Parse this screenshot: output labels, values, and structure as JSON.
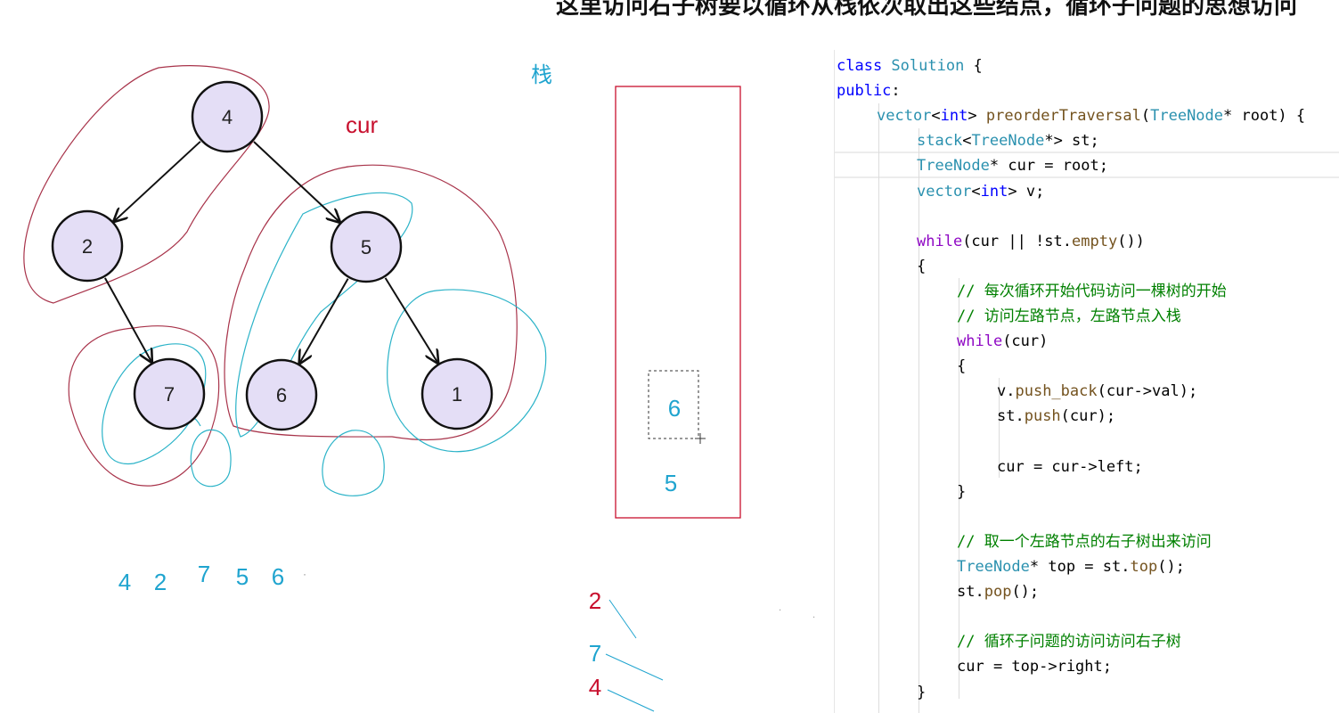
{
  "caption": "这里访问右子树要以循环从栈依次取出这些结点，循环子问题的思想访问",
  "tree": {
    "nodes": [
      {
        "id": "n4",
        "label": "4"
      },
      {
        "id": "n2",
        "label": "2"
      },
      {
        "id": "n5",
        "label": "5"
      },
      {
        "id": "n7",
        "label": "7"
      },
      {
        "id": "n6",
        "label": "6"
      },
      {
        "id": "n1",
        "label": "1"
      }
    ],
    "edges": [
      [
        "n4",
        "n2"
      ],
      [
        "n4",
        "n5"
      ],
      [
        "n2",
        "n7"
      ],
      [
        "n5",
        "n6"
      ],
      [
        "n5",
        "n1"
      ]
    ]
  },
  "annotations": {
    "cur_label": "cur",
    "stack_label": "栈",
    "stack_items": [
      "6",
      "5"
    ],
    "output_sequence": [
      "4",
      "2",
      "7",
      "5",
      "6"
    ],
    "popped": [
      "2",
      "7",
      "4"
    ]
  },
  "code": {
    "lines": [
      {
        "indent": 0,
        "tokens": [
          [
            "kw",
            "class"
          ],
          [
            "",
            ""
          ],
          [
            "ty",
            " Solution"
          ],
          [
            "",
            " {"
          ]
        ]
      },
      {
        "indent": 0,
        "tokens": [
          [
            "kw",
            "public"
          ],
          [
            "",
            ":"
          ]
        ]
      },
      {
        "indent": 1,
        "tokens": [
          [
            "ty",
            "vector"
          ],
          [
            "",
            "<"
          ],
          [
            "kw",
            "int"
          ],
          [
            "",
            "> "
          ],
          [
            "fn",
            "preorderTraversal"
          ],
          [
            "",
            "("
          ],
          [
            "ty",
            "TreeNode"
          ],
          [
            "",
            "* root) {"
          ]
        ]
      },
      {
        "indent": 2,
        "tokens": [
          [
            "ty",
            "stack"
          ],
          [
            "",
            "<"
          ],
          [
            "ty",
            "TreeNode"
          ],
          [
            "",
            "*> st;"
          ]
        ]
      },
      {
        "indent": 2,
        "tokens": [
          [
            "ty",
            "TreeNode"
          ],
          [
            "",
            "* cur = root;"
          ]
        ]
      },
      {
        "indent": 2,
        "tokens": [
          [
            "ty",
            "vector"
          ],
          [
            "",
            "<"
          ],
          [
            "kw",
            "int"
          ],
          [
            "",
            "> v;"
          ]
        ]
      },
      {
        "indent": 0,
        "tokens": []
      },
      {
        "indent": 2,
        "tokens": [
          [
            "ctl",
            "while"
          ],
          [
            "",
            "(cur || !st."
          ],
          [
            "fn",
            "empty"
          ],
          [
            "",
            "())"
          ]
        ]
      },
      {
        "indent": 2,
        "tokens": [
          [
            "",
            "{"
          ]
        ]
      },
      {
        "indent": 3,
        "tokens": [
          [
            "cm",
            "// 每次循环开始代码访问一棵树的开始"
          ]
        ]
      },
      {
        "indent": 3,
        "tokens": [
          [
            "cm",
            "// 访问左路节点，左路节点入栈"
          ]
        ]
      },
      {
        "indent": 3,
        "tokens": [
          [
            "ctl",
            "while"
          ],
          [
            "",
            "(cur)"
          ]
        ]
      },
      {
        "indent": 3,
        "tokens": [
          [
            "",
            "{"
          ]
        ]
      },
      {
        "indent": 4,
        "tokens": [
          [
            "",
            "v."
          ],
          [
            "fn",
            "push_back"
          ],
          [
            "",
            "(cur->val);"
          ]
        ]
      },
      {
        "indent": 4,
        "tokens": [
          [
            "",
            "st."
          ],
          [
            "fn",
            "push"
          ],
          [
            "",
            "(cur);"
          ]
        ]
      },
      {
        "indent": 0,
        "tokens": []
      },
      {
        "indent": 4,
        "tokens": [
          [
            "",
            "cur = cur->left;"
          ]
        ]
      },
      {
        "indent": 3,
        "tokens": [
          [
            "",
            "}"
          ]
        ]
      },
      {
        "indent": 0,
        "tokens": []
      },
      {
        "indent": 3,
        "tokens": [
          [
            "cm",
            "// 取一个左路节点的右子树出来访问"
          ]
        ]
      },
      {
        "indent": 3,
        "tokens": [
          [
            "ty",
            "TreeNode"
          ],
          [
            "",
            "* top = st."
          ],
          [
            "fn",
            "top"
          ],
          [
            "",
            "();"
          ]
        ]
      },
      {
        "indent": 3,
        "tokens": [
          [
            "",
            "st."
          ],
          [
            "fn",
            "pop"
          ],
          [
            "",
            "();"
          ]
        ]
      },
      {
        "indent": 0,
        "tokens": []
      },
      {
        "indent": 3,
        "tokens": [
          [
            "cm",
            "// 循环子问题的访问访问右子树"
          ]
        ]
      },
      {
        "indent": 3,
        "tokens": [
          [
            "",
            "cur = top->right;"
          ]
        ]
      },
      {
        "indent": 2,
        "tokens": [
          [
            "",
            "}"
          ]
        ]
      }
    ]
  }
}
